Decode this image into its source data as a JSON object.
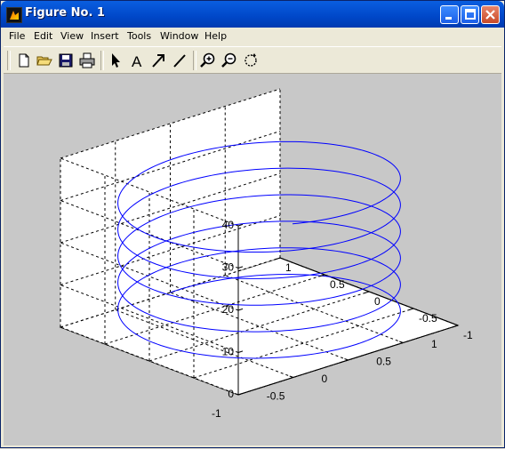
{
  "window": {
    "title": "Figure No. 1"
  },
  "menu": [
    "File",
    "Edit",
    "View",
    "Insert",
    "Tools",
    "Window",
    "Help"
  ],
  "toolbar": {
    "tools": [
      "new-file-icon",
      "open-folder-icon",
      "save-icon",
      "print-icon",
      "arrow-select-icon",
      "text-icon",
      "arrow-draw-icon",
      "line-draw-icon",
      "zoom-in-icon",
      "zoom-out-icon",
      "rotate-3d-icon"
    ]
  },
  "colors": {
    "titlebar": "#0054e3",
    "plot_background": "#c8c8c8",
    "axes_face": "#ffffff",
    "line": "#0000ff"
  },
  "chart_data": {
    "type": "line",
    "projection": "3d",
    "xlim": [
      -1,
      1
    ],
    "ylim": [
      -1,
      1
    ],
    "zlim": [
      0,
      40
    ],
    "x_ticks": [
      "-1",
      "-0.5",
      "0",
      "0.5",
      "1"
    ],
    "y_ticks": [
      "-1",
      "-0.5",
      "0",
      "0.5",
      "1"
    ],
    "z_ticks": [
      "0",
      "10",
      "20",
      "30",
      "40"
    ],
    "grid": true,
    "series": [
      {
        "function": "x = sin(t), y = cos(t), z = t",
        "t_range": [
          0,
          35
        ]
      }
    ]
  }
}
